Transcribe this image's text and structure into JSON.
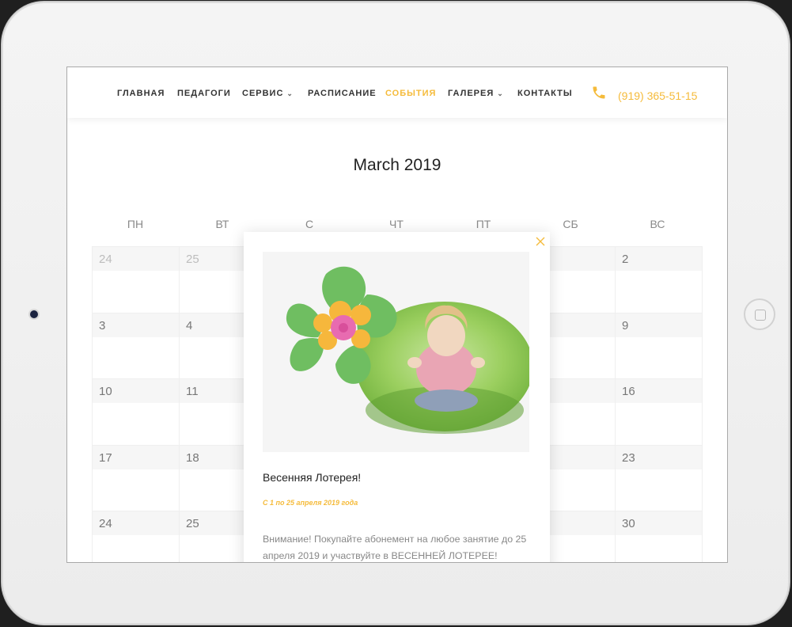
{
  "nav": {
    "items": [
      {
        "label": "ГЛАВНАЯ",
        "active": false,
        "dropdown": false
      },
      {
        "label": "ПЕДАГОГИ",
        "active": false,
        "dropdown": false
      },
      {
        "label": "СЕРВИС",
        "active": false,
        "dropdown": true
      },
      {
        "label": "РАСПИСАНИЕ",
        "active": false,
        "dropdown": false
      },
      {
        "label": "СОБЫТИЯ",
        "active": true,
        "dropdown": false
      },
      {
        "label": "ГАЛЕРЕЯ",
        "active": false,
        "dropdown": true
      },
      {
        "label": "КОНТАКТЫ",
        "active": false,
        "dropdown": false
      }
    ],
    "phone": "(919) 365-51-15",
    "chevron": "⌄"
  },
  "calendar": {
    "title": "March  2019",
    "weekdays": [
      "ПН",
      "ВТ",
      "С",
      "ЧТ",
      "ПТ",
      "СБ",
      "ВС"
    ],
    "rows": [
      {
        "mon": "24",
        "tue": "25",
        "sun": "2"
      },
      {
        "mon": "3",
        "tue": "4",
        "sun": "9"
      },
      {
        "mon": "10",
        "tue": "11",
        "sun": "16"
      },
      {
        "mon": "17",
        "tue": "18",
        "sun": "23"
      },
      {
        "mon": "24",
        "tue": "25",
        "sun": "30"
      }
    ]
  },
  "modal": {
    "title": "Весенняя Лотерея!",
    "date": "С 1 по 25 апреля 2019 года",
    "text": "Внимание! Покупайте абонемент на любое занятие до 25 апреля 2019 и участвуйте в ВЕСЕННЕЙ ЛОТЕРЕЕ!"
  },
  "colors": {
    "accent": "#f5bb3b",
    "flower_green": "#6fbe61",
    "flower_orange": "#f6b73c",
    "flower_pink": "#e86bb0"
  },
  "icons": [
    "phone-icon",
    "close-icon",
    "chevron-down-icon"
  ]
}
